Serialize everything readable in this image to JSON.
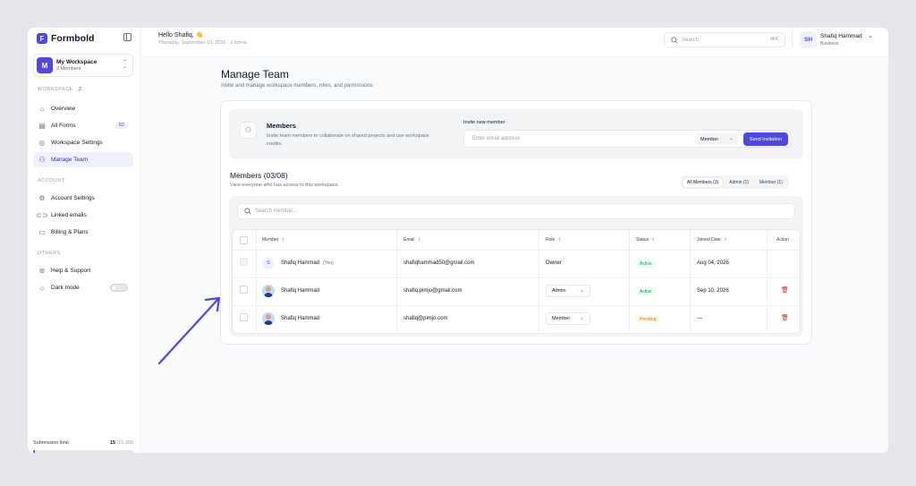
{
  "app": {
    "name": "Formbold"
  },
  "workspace": {
    "initial": "M",
    "name": "My Workspace",
    "members": "2 Members"
  },
  "sidebar": {
    "section_workspace": "WORKSPACE",
    "workspace_count": "2",
    "items": [
      {
        "label": "Overview",
        "icon": "home-icon"
      },
      {
        "label": "All Forms",
        "icon": "document-icon",
        "count": "62"
      },
      {
        "label": "Workspace Settings",
        "icon": "gear-icon"
      },
      {
        "label": "Manage Team",
        "icon": "users-icon",
        "active": true
      }
    ],
    "section_account": "ACCOUNT",
    "account_items": [
      {
        "label": "Account Settings",
        "icon": "gear-icon"
      },
      {
        "label": "Linked emails",
        "icon": "link-icon"
      },
      {
        "label": "Billing & Plans",
        "icon": "credit-card-icon"
      }
    ],
    "section_others": "OTHERS",
    "others_items": [
      {
        "label": "Help & Support",
        "icon": "lifebuoy-icon"
      },
      {
        "label": "Dark mode",
        "icon": "sun-icon",
        "toggle": false
      }
    ],
    "limit": {
      "label": "Submission limit",
      "used": "15",
      "total": "/15,000",
      "fraction": 0.001
    }
  },
  "header": {
    "greeting": "Hello Shafiq, 👋",
    "date": "Thursday, September 10, 2026 · 2 forms",
    "search_placeholder": "Search",
    "shortcut": "⌘K",
    "user_initials": "SH",
    "user_name": "Shafiq Hammad",
    "user_role": "Business"
  },
  "page": {
    "title": "Manage Team",
    "subtitle": "Invite and manage workspace members, roles, and permissions"
  },
  "invite": {
    "title": "Members",
    "description": "Invite team members to collaborate on shared projects and use workspace credits.",
    "label": "Invite new member",
    "placeholder": "Enter email address",
    "role": "Member",
    "send": "Send Invitation"
  },
  "members": {
    "title": "Members (03/08)",
    "subtitle": "View everyone who has access to this workspace.",
    "filters": [
      "All Members (3)",
      "Admin (1)",
      "Member (1)"
    ],
    "search_placeholder": "Search member...",
    "columns": [
      "Member",
      "Email",
      "Role",
      "Status",
      "Joined Date",
      "Action"
    ],
    "rows": [
      {
        "name": "Shafiq Hammad",
        "you": "(You)",
        "initial": "S",
        "email": "shafiqhammad50@gmail.com",
        "role": "Owner",
        "status": "Active",
        "joined": "Aug 04, 2026"
      },
      {
        "name": "Shafiq Hammad",
        "email": "shafiq.pimjo@gmail.com",
        "role": "Admin",
        "status": "Active",
        "joined": "Sep 10, 2026"
      },
      {
        "name": "Shafiq Hammad",
        "email": "shafiq@pimjo.com",
        "role": "Member",
        "status": "Pending",
        "joined": "—"
      }
    ]
  },
  "colors": {
    "accent": "#4f46e5",
    "active": "#16a34a",
    "pending": "#d97706",
    "danger": "#dc2626"
  }
}
